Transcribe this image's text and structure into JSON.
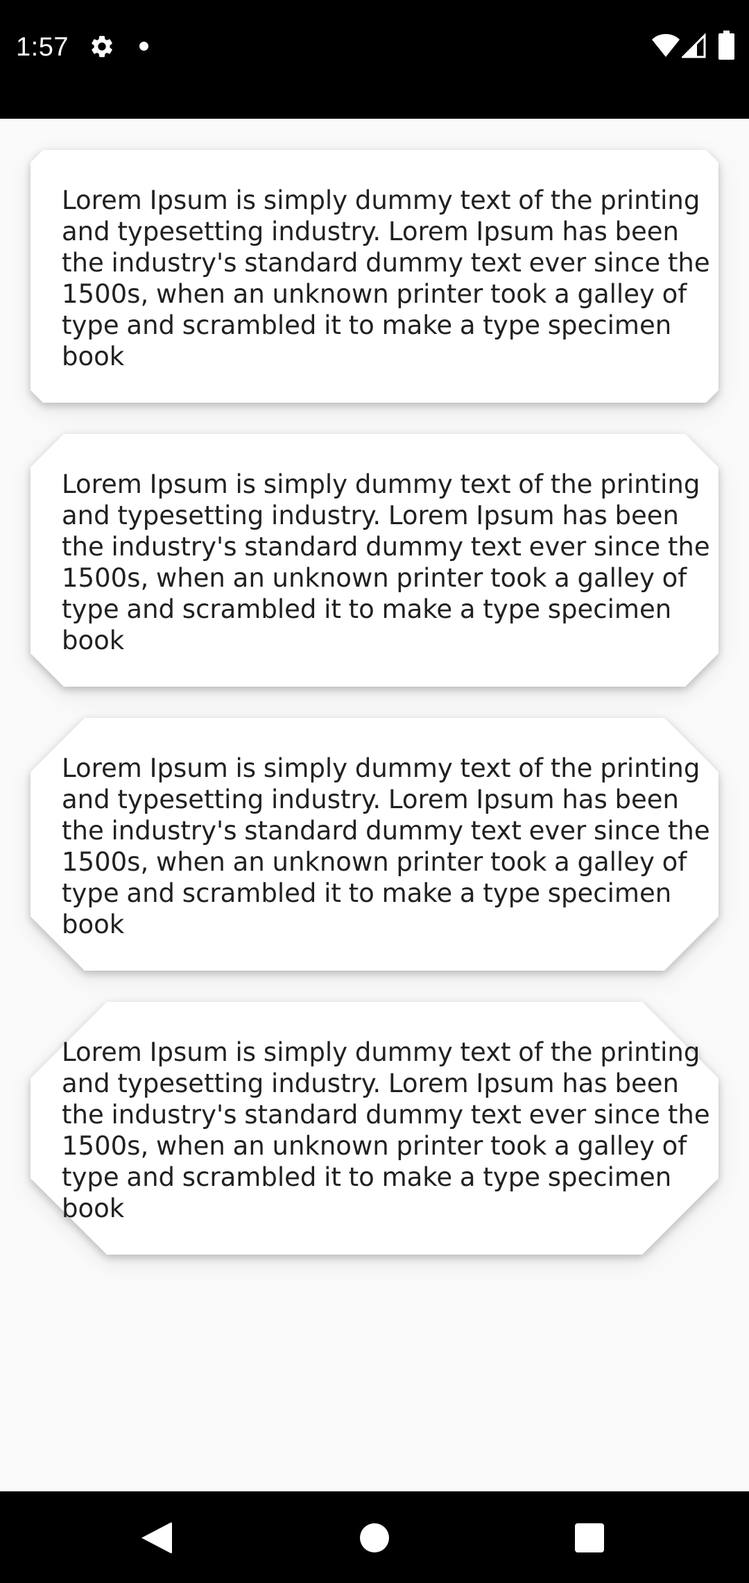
{
  "status_bar": {
    "time": "1:57",
    "icons": [
      "gear-icon",
      "notification-dot-icon",
      "wifi-icon",
      "signal-icon",
      "battery-icon"
    ],
    "background": "#000000",
    "foreground": "#ffffff"
  },
  "cards": [
    {
      "text": "Lorem Ipsum is simply dummy text of the printing and typesetting industry. Lorem Ipsum has been the industry's standard dummy text ever since the 1500s, when an unknown printer took a galley of type and scrambled it to make a type specimen book"
    },
    {
      "text": "Lorem Ipsum is simply dummy text of the printing and typesetting industry. Lorem Ipsum has been the industry's standard dummy text ever since the 1500s, when an unknown printer took a galley of type and scrambled it to make a type specimen book"
    },
    {
      "text": "Lorem Ipsum is simply dummy text of the printing and typesetting industry. Lorem Ipsum has been the industry's standard dummy text ever since the 1500s, when an unknown printer took a galley of type and scrambled it to make a type specimen book"
    },
    {
      "text": "Lorem Ipsum is simply dummy text of the printing and typesetting industry. Lorem Ipsum has been the industry's standard dummy text ever since the 1500s, when an unknown printer took a galley of type and scrambled it to make a type specimen book"
    }
  ],
  "nav_bar": {
    "buttons": [
      "back-icon",
      "home-icon",
      "recents-icon"
    ]
  },
  "colors": {
    "background": "#fafafa",
    "card": "#ffffff",
    "text": "#212121"
  }
}
